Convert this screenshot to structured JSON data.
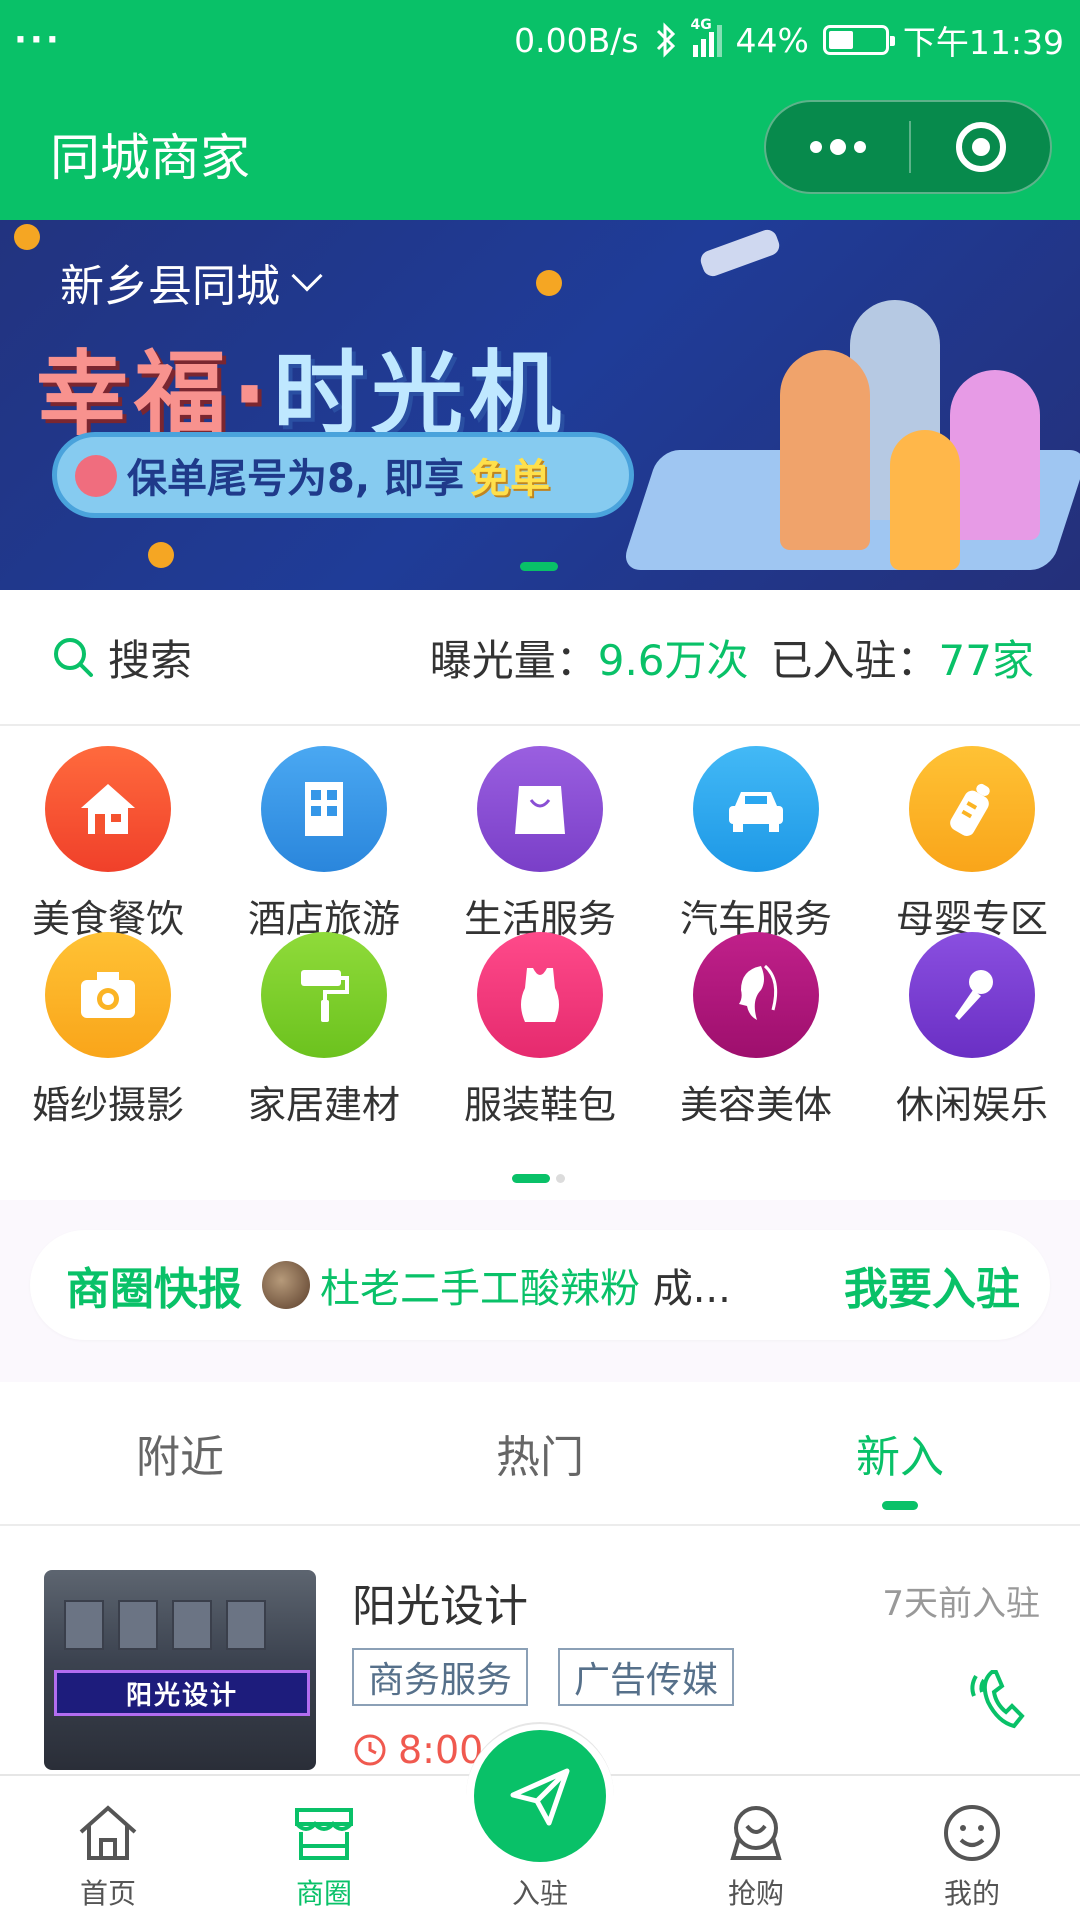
{
  "status_bar": {
    "left": "···",
    "speed": "0.00B/s",
    "network": "4G",
    "battery": "44%",
    "battery_level": 0.44,
    "time": "下午11:39"
  },
  "titlebar": {
    "title": "同城商家"
  },
  "banner": {
    "city": "新乡县同城",
    "slogan_part1": "幸福·",
    "slogan_part2": "时光机",
    "pill_text": "保单尾号为8, 即享",
    "pill_highlight": "免单"
  },
  "stats": {
    "search_label": "搜索",
    "exposure_label": "曝光量：",
    "exposure_value": "9.6万次",
    "joined_label": "已入驻：",
    "joined_value": "77家"
  },
  "categories": [
    {
      "label": "美食餐饮",
      "icon": "house-icon",
      "color": "#f5522f"
    },
    {
      "label": "酒店旅游",
      "icon": "building-icon",
      "color": "#3597e8"
    },
    {
      "label": "生活服务",
      "icon": "shopping-bag-icon",
      "color": "#8a4fd4"
    },
    {
      "label": "汽车服务",
      "icon": "car-icon",
      "color": "#2aa7f0"
    },
    {
      "label": "母婴专区",
      "icon": "baby-bottle-icon",
      "color": "#fbb424"
    },
    {
      "label": "婚纱摄影",
      "icon": "camera-icon",
      "color": "#fbb424"
    },
    {
      "label": "家居建材",
      "icon": "paint-roller-icon",
      "color": "#7fd12a"
    },
    {
      "label": "服装鞋包",
      "icon": "clothing-icon",
      "color": "#f2357e"
    },
    {
      "label": "美容美体",
      "icon": "woman-profile-icon",
      "color": "#b4157c"
    },
    {
      "label": "休闲娱乐",
      "icon": "microphone-icon",
      "color": "#7b3fd0"
    }
  ],
  "news": {
    "tag": "商圈快报",
    "shop": "杜老二手工酸辣粉",
    "suffix": " 成...",
    "join": "我要入驻"
  },
  "tabs": [
    "附近",
    "热门",
    "新入"
  ],
  "active_tab": 2,
  "merchant": {
    "name": "阳光设计",
    "time": "7天前入驻",
    "tags": [
      "商务服务",
      "广告传媒"
    ],
    "hours": "8:00",
    "sign": "阳光设计"
  },
  "nav": [
    "首页",
    "商圈",
    "入驻",
    "抢购",
    "我的"
  ],
  "colors": {
    "brand": "#09c168",
    "hours": "#f0594f"
  }
}
